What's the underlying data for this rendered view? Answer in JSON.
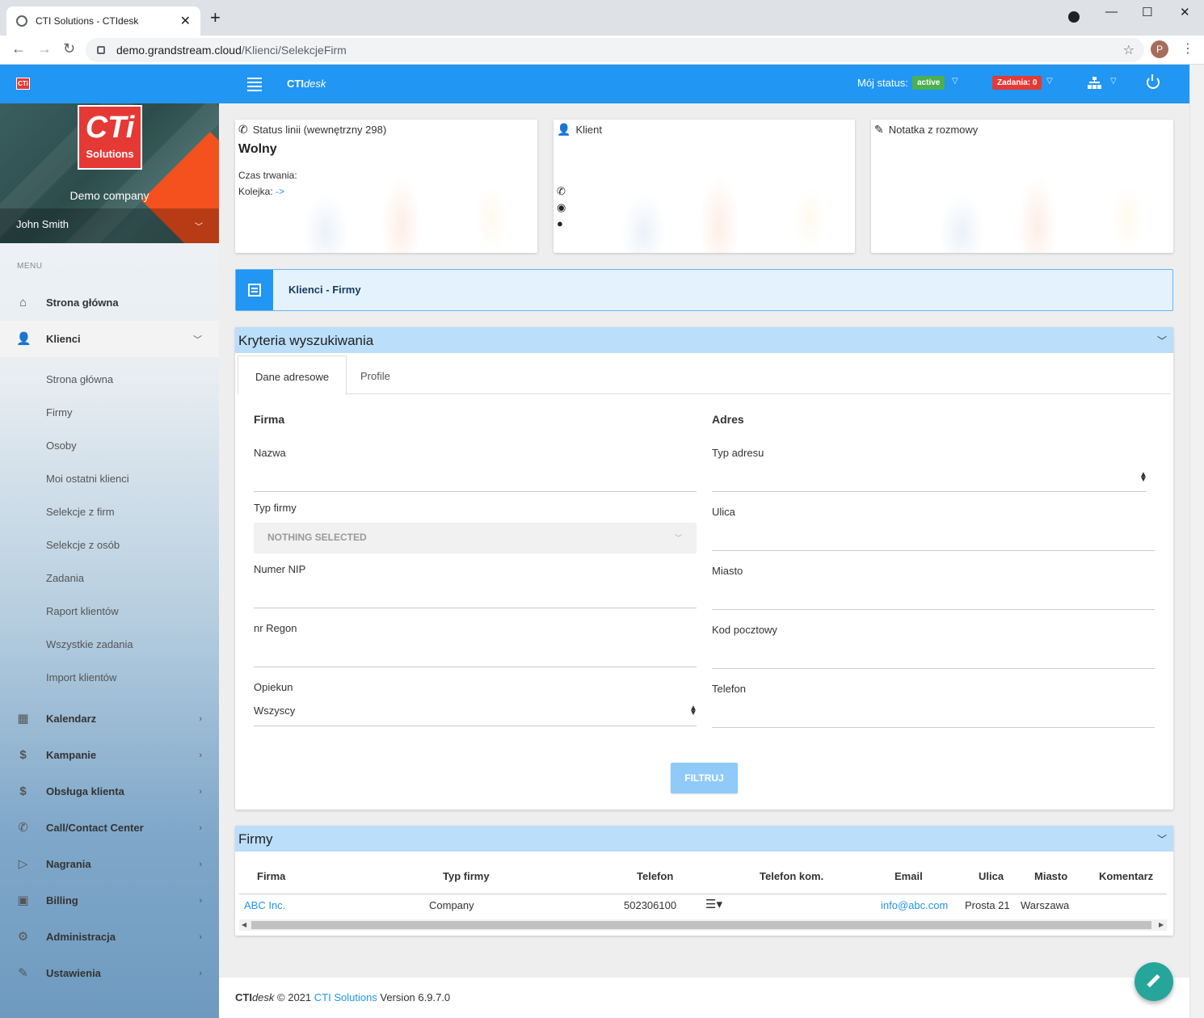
{
  "browser": {
    "tab_title": "CTI Solutions - CTIdesk",
    "url_host": "demo.grandstream.cloud",
    "url_path": "/Klienci/SelekcjeFirm",
    "profile_initial": "P"
  },
  "appbar": {
    "logo_small": "CTi",
    "brand_bold": "CTI",
    "brand_italic": "desk",
    "status_label": "Mój status:",
    "status_value": "active",
    "tasks_label": "Zadania: 0"
  },
  "sidebar": {
    "logo_cti": "CTi",
    "logo_solutions": "Solutions",
    "company": "Demo company",
    "user": "John Smith",
    "menu_label": "MENU",
    "items": [
      {
        "label": "Strona główna"
      },
      {
        "label": "Klienci"
      },
      {
        "label": "Kalendarz"
      },
      {
        "label": "Kampanie"
      },
      {
        "label": "Obsługa klienta"
      },
      {
        "label": "Call/Contact Center"
      },
      {
        "label": "Nagrania"
      },
      {
        "label": "Billing"
      },
      {
        "label": "Administracja"
      },
      {
        "label": "Ustawienia"
      }
    ],
    "sub_items": [
      {
        "label": "Strona główna"
      },
      {
        "label": "Firmy"
      },
      {
        "label": "Osoby"
      },
      {
        "label": "Moi ostatni klienci"
      },
      {
        "label": "Selekcje z firm"
      },
      {
        "label": "Selekcje z osób"
      },
      {
        "label": "Zadania"
      },
      {
        "label": "Raport klientów"
      },
      {
        "label": "Wszystkie zadania"
      },
      {
        "label": "Import klientów"
      }
    ]
  },
  "cards": {
    "line_status_title": "Status linii (wewnętrzny 298)",
    "line_status_value": "Wolny",
    "duration_label": "Czas trwania:",
    "queue_label": "Kolejka:",
    "queue_link": "->",
    "client_title": "Klient",
    "note_title": "Notatka z rozmowy"
  },
  "breadcrumb": {
    "section": "Klienci",
    "separator": " - ",
    "page": "Firmy"
  },
  "search": {
    "title": "Kryteria wyszukiwania",
    "tabs": [
      {
        "label": "Dane adresowe"
      },
      {
        "label": "Profile"
      }
    ],
    "firma_title": "Firma",
    "adres_title": "Adres",
    "fields": {
      "nazwa": "Nazwa",
      "typ_firmy": "Typ firmy",
      "typ_firmy_value": "NOTHING SELECTED",
      "nip": "Numer NIP",
      "regon": "nr Regon",
      "opiekun": "Opiekun",
      "opiekun_value": "Wszyscy",
      "typ_adresu": "Typ adresu",
      "ulica": "Ulica",
      "miasto": "Miasto",
      "kod": "Kod pocztowy",
      "telefon": "Telefon"
    },
    "filter_button": "FILTRUJ"
  },
  "results": {
    "title": "Firmy",
    "columns": [
      "Firma",
      "Typ firmy",
      "Telefon",
      "Telefon kom.",
      "Email",
      "Ulica",
      "Miasto",
      "Komentarz"
    ],
    "rows": [
      {
        "firma": "ABC Inc.",
        "typ": "Company",
        "telefon": "502306100",
        "telefon_kom": "",
        "email": "info@abc.com",
        "ulica": "Prosta 21",
        "miasto": "Warszawa",
        "komentarz": ""
      }
    ]
  },
  "footer": {
    "brand_bold": "CTI",
    "brand_italic": "desk",
    "copyright": " © 2021 ",
    "company_link": "CTI Solutions",
    "version": " Version 6.9.7.0"
  }
}
